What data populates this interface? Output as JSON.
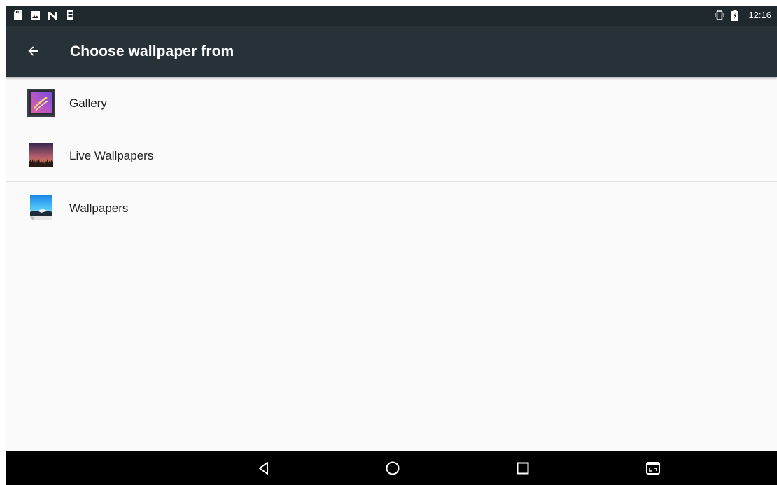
{
  "status_bar": {
    "left_icons": [
      "sd-card-icon",
      "image-icon",
      "n-notification-icon",
      "log-file-icon"
    ],
    "vibrate_icon": "vibrate-icon",
    "battery_icon": "battery-charging-icon",
    "time": "12:16"
  },
  "app_bar": {
    "back_icon": "back-arrow-icon",
    "title": "Choose wallpaper from"
  },
  "list": {
    "items": [
      {
        "label": "Gallery",
        "icon": "gallery-icon"
      },
      {
        "label": "Live Wallpapers",
        "icon": "live-wallpapers-icon"
      },
      {
        "label": "Wallpapers",
        "icon": "wallpapers-icon"
      }
    ]
  },
  "nav_bar": {
    "buttons": [
      "back-triangle-icon",
      "home-circle-icon",
      "recents-square-icon",
      "screenshot-icon"
    ]
  },
  "colors": {
    "status_bar": "#1f282c",
    "app_bar": "#263238",
    "background": "#fafafa",
    "nav_bar": "#000000"
  }
}
